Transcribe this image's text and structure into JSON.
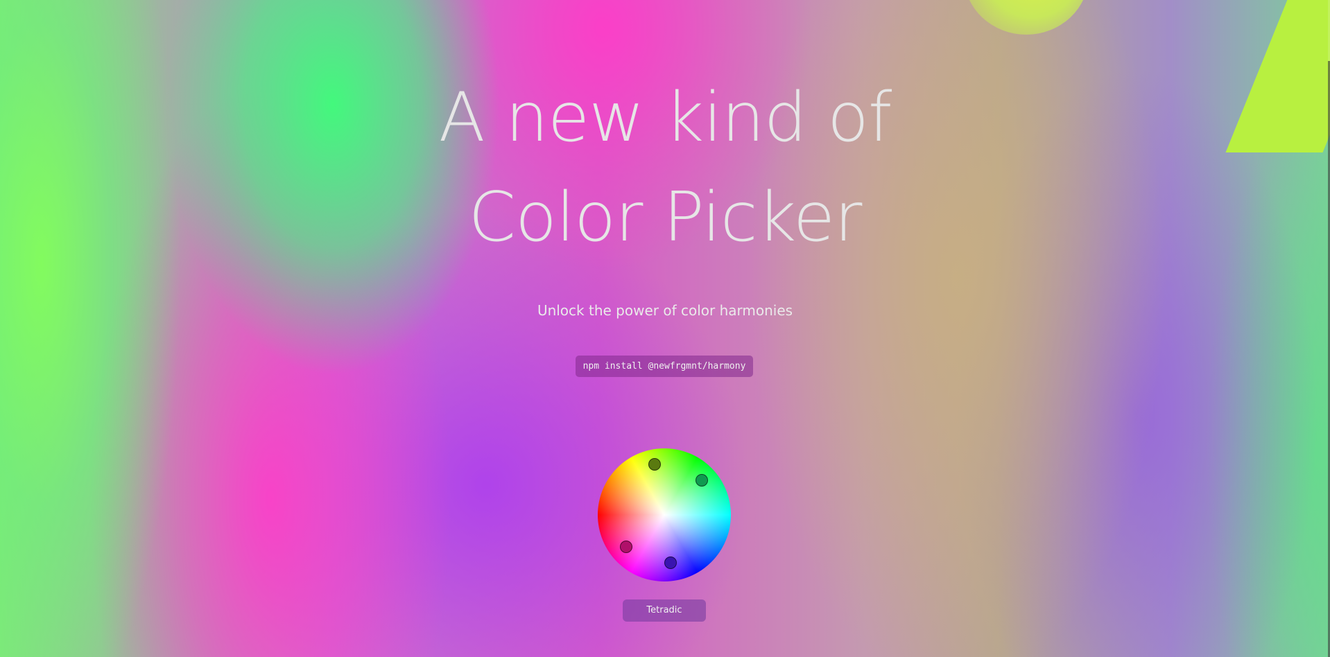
{
  "hero": {
    "headline_line1": "A new kind of",
    "headline_line2": "Color Picker",
    "subtitle": "Unlock the power of color harmonies",
    "install_command": "npm install @newfrgmnt/harmony"
  },
  "picker": {
    "harmony_label": "Tetradic",
    "handle_colors": [
      "#5a7a10",
      "#109a50",
      "#b0106a",
      "#3a14b0"
    ]
  }
}
